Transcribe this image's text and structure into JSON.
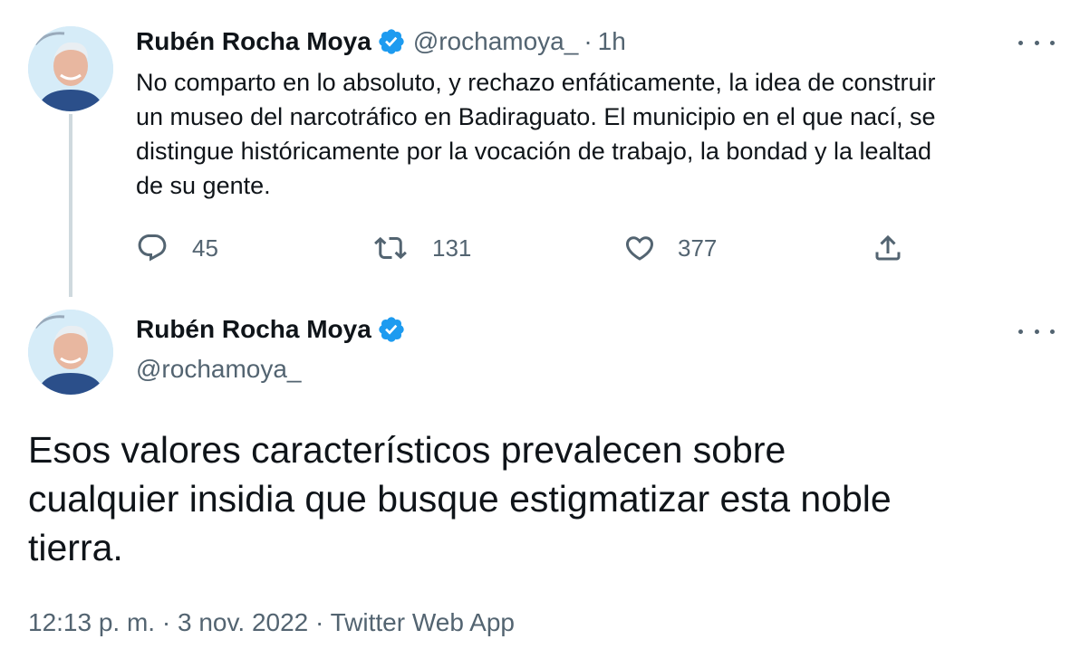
{
  "tweet1": {
    "author_name": "Rubén Rocha Moya",
    "handle": "@rochamoya_",
    "separator": "·",
    "time": "1h",
    "text_lines": [
      "No comparto en lo absoluto, y rechazo enfáticamente, la idea de construir",
      "un museo del narcotráfico en Badiraguato. El municipio en el que nací, se",
      "distingue históricamente por la vocación de trabajo, la bondad y la lealtad",
      "de su gente."
    ],
    "actions": {
      "reply_count": "45",
      "retweet_count": "131",
      "like_count": "377"
    },
    "icons": [
      "reply-icon",
      "retweet-icon",
      "like-icon",
      "share-icon",
      "verified-icon",
      "more-icon"
    ]
  },
  "tweet2": {
    "author_name": "Rubén Rocha Moya",
    "handle": "@rochamoya_",
    "text_lines": [
      "Esos valores característicos prevalecen sobre",
      "cualquier insidia que busque estigmatizar esta noble",
      "tierra."
    ],
    "meta": "12:13 p. m. · 3 nov. 2022 · Twitter Web App"
  },
  "colors": {
    "verified": "#1d9bf0",
    "secondary_text": "#536471",
    "thread_line": "#cfd9de",
    "primary_text": "#0f1419"
  }
}
